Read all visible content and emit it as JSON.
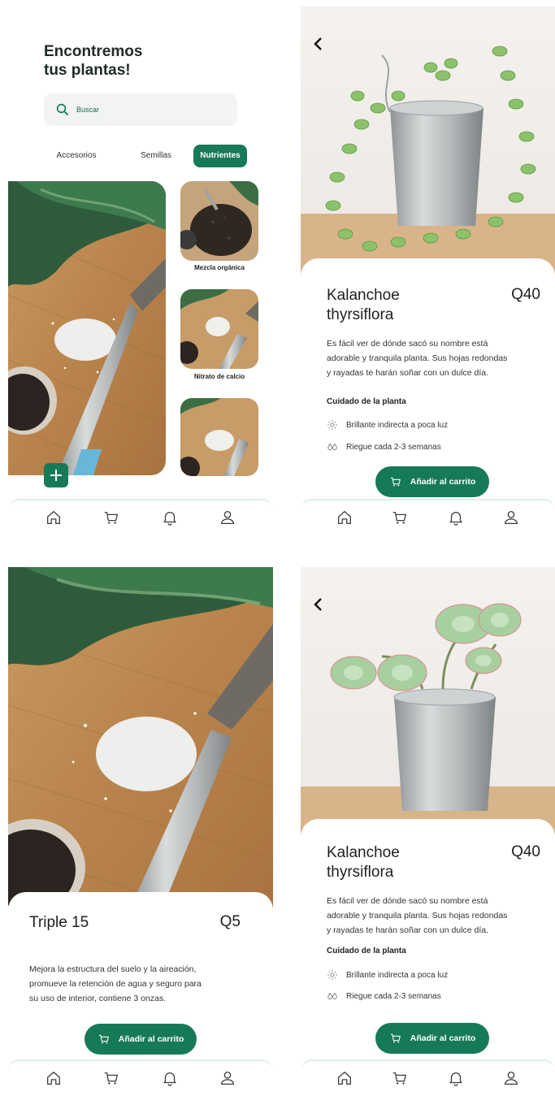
{
  "colors": {
    "accent": "#177a56",
    "search_bg": "#f1f4f2",
    "tab_border": "#dcefe6"
  },
  "home": {
    "title_line1": "Encontremos",
    "title_line2": "tus plantas!",
    "search_placeholder": "Buscar",
    "categories": [
      {
        "label": "Accesorios",
        "active": false
      },
      {
        "label": "Semillas",
        "active": false
      },
      {
        "label": "Nutrientes",
        "active": true
      }
    ],
    "products": [
      {
        "label": "Mezcla orgánica"
      },
      {
        "label": "Nitrato de calcio"
      },
      {
        "label": ""
      }
    ],
    "add_icon": "plus-icon"
  },
  "detail1": {
    "name_line1": "Kalanchoe",
    "name_line2": "thyrsiflora",
    "price": "Q40",
    "desc_line1": "Es fácil ver de dónde sacó su nombre está",
    "desc_line2": "adorable y tranquila planta. Sus hojas redondas",
    "desc_line3": "y rayadas te harán soñar con un dulce día.",
    "care_title": "Cuidado de la planta",
    "care_light": "Brillante indirecta a poca luz",
    "care_water": "Riegue cada 2-3 semanas",
    "cart_label": "Añadir al carrito"
  },
  "detail2": {
    "name": "Triple 15",
    "price": "Q5",
    "desc_line1": "Mejora la estructura del suelo y la aireación,",
    "desc_line2": "promueve la retención de agua y seguro para",
    "desc_line3": "su uso de interior, contiene 3 onzas.",
    "cart_label": "Añadir al carrito"
  },
  "detail3": {
    "name_line1": "Kalanchoe",
    "name_line2": "thyrsiflora",
    "price": "Q40",
    "desc_line1": "Es fácil ver de dónde sacó su nombre está",
    "desc_line2": "adorable y tranquila planta. Sus hojas redondas",
    "desc_line3": "y rayadas te harán soñar con un dulce día.",
    "care_title": "Cuidado de la planta",
    "care_light": "Brillante indirecta a poca luz",
    "care_water": "Riegue cada 2-3 semanas",
    "cart_label": "Añadir al carrito"
  },
  "tabbar": [
    "home-icon",
    "cart-icon",
    "bell-icon",
    "user-icon"
  ]
}
